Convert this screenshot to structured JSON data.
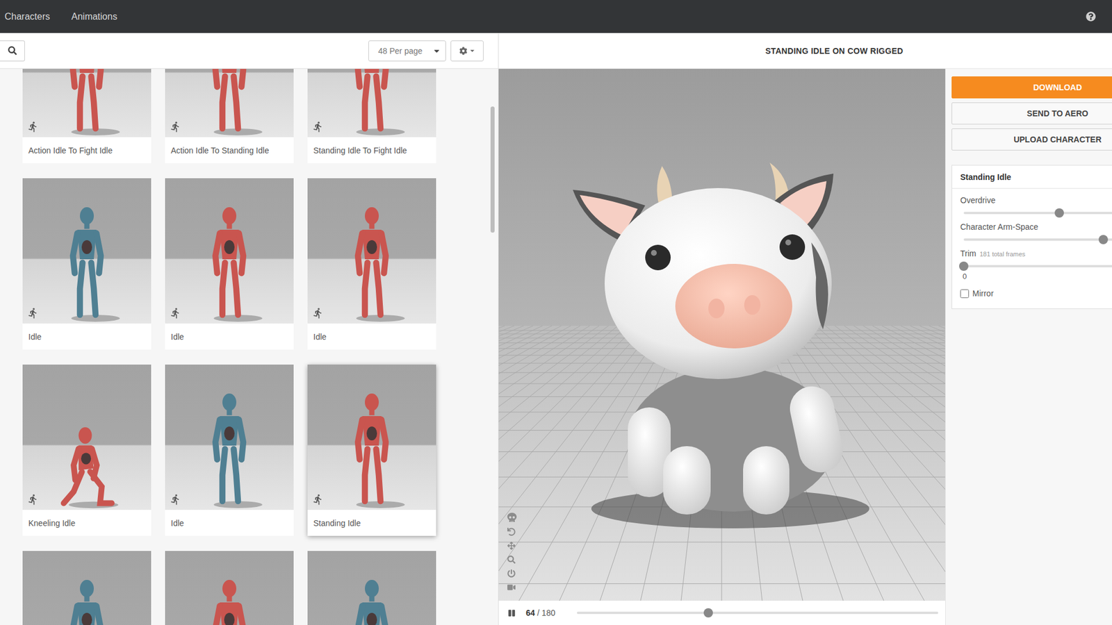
{
  "nav": {
    "tabs": [
      {
        "label": "Characters"
      },
      {
        "label": "Animations"
      }
    ]
  },
  "toolbar": {
    "per_page": "48 Per page"
  },
  "animations": [
    {
      "label": "Action Idle To Fight Idle",
      "color": "#c9554f",
      "kind": "standing",
      "selected": false
    },
    {
      "label": "Action Idle To Standing Idle",
      "color": "#c9554f",
      "kind": "standing",
      "selected": false
    },
    {
      "label": "Standing Idle To Fight Idle",
      "color": "#c9554f",
      "kind": "standing",
      "selected": false
    },
    {
      "label": "Idle",
      "color": "#4f7f92",
      "kind": "standing",
      "selected": false
    },
    {
      "label": "Idle",
      "color": "#c9554f",
      "kind": "standing",
      "selected": false
    },
    {
      "label": "Idle",
      "color": "#c9554f",
      "kind": "standing",
      "selected": false
    },
    {
      "label": "Kneeling Idle",
      "color": "#c9554f",
      "kind": "kneeling",
      "selected": false
    },
    {
      "label": "Idle",
      "color": "#4f7f92",
      "kind": "standing",
      "selected": false
    },
    {
      "label": "Standing Idle",
      "color": "#c9554f",
      "kind": "standing",
      "selected": true
    },
    {
      "label": "",
      "color": "#4f7f92",
      "kind": "standing",
      "selected": false
    },
    {
      "label": "",
      "color": "#c9554f",
      "kind": "standing",
      "selected": false
    },
    {
      "label": "",
      "color": "#4f7f92",
      "kind": "standing",
      "selected": false
    }
  ],
  "viewer": {
    "title": "STANDING IDLE ON COW RIGGED",
    "frame": "64",
    "total": "/ 180",
    "playing": true,
    "progress": 0.364
  },
  "actions": [
    {
      "label": "DOWNLOAD",
      "primary": true
    },
    {
      "label": "SEND TO AERO",
      "primary": false
    },
    {
      "label": "UPLOAD CHARACTER",
      "primary": false
    }
  ],
  "settings": {
    "title": "Standing Idle",
    "sliders": [
      {
        "label": "Overdrive",
        "note": "",
        "level": 0.5,
        "value": ""
      },
      {
        "label": "Character Arm-Space",
        "note": "",
        "level": 0.73,
        "value": ""
      },
      {
        "label": "Trim",
        "note": "181 total frames",
        "level": 0,
        "value": "0"
      }
    ],
    "mirror": {
      "label": "Mirror",
      "checked": false
    }
  }
}
